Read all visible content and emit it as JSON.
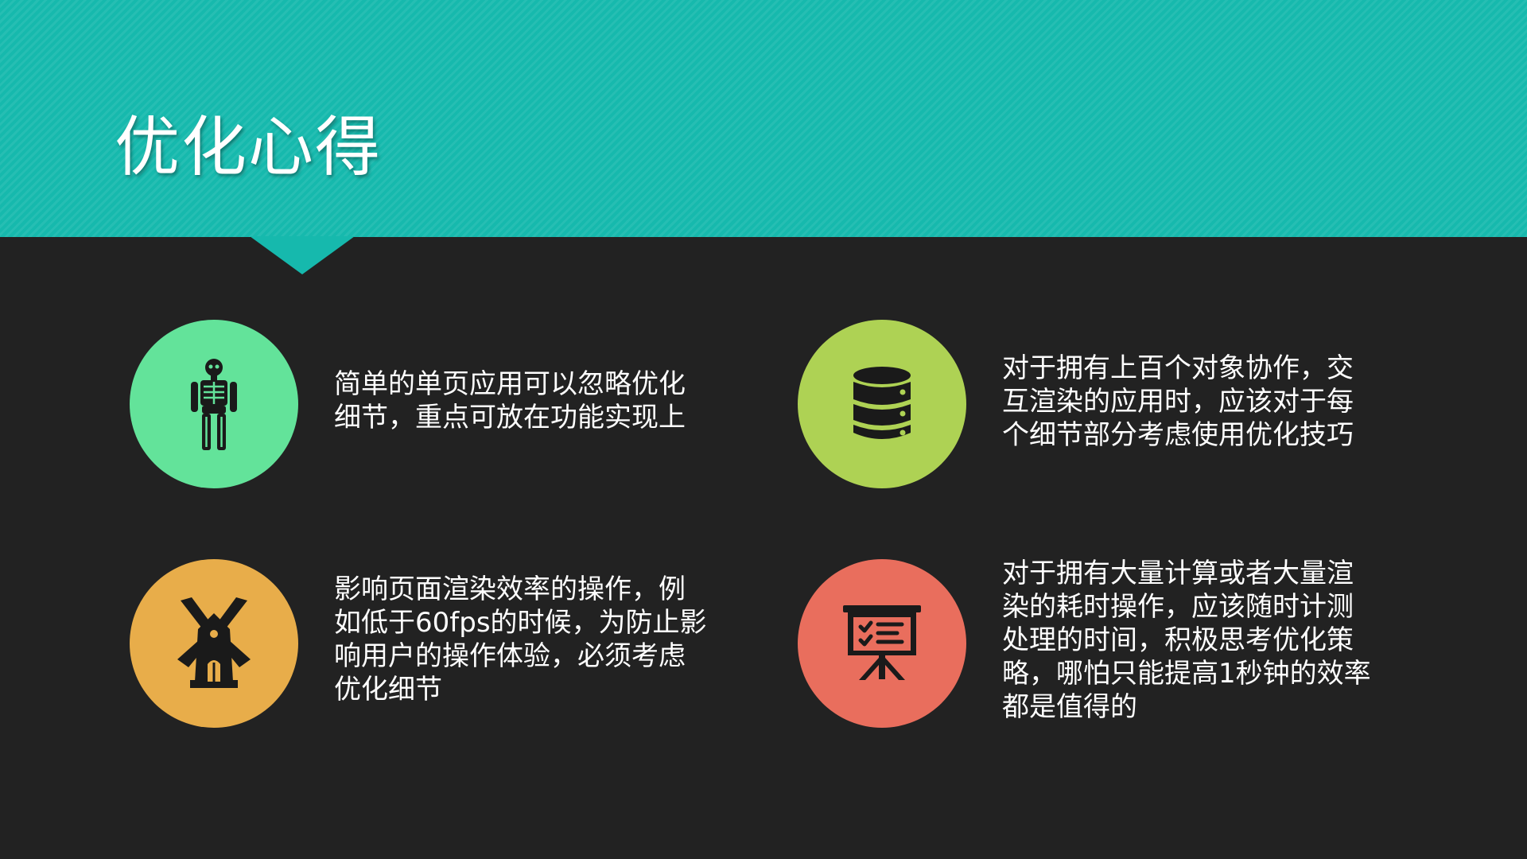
{
  "slide": {
    "title": "优化心得"
  },
  "colors": {
    "banner": "#16b9ad",
    "background": "#222222",
    "text": "#ffffff",
    "icon": "#1a1a1a"
  },
  "items": [
    {
      "icon": "skeleton-icon",
      "color": "#63e39a",
      "text": "简单的单页应用可以忽略优化\n细节，重点可放在功能实现上"
    },
    {
      "icon": "database-icon",
      "color": "#aed254",
      "text": "对于拥有上百个对象协作，交\n互渲染的应用时，应该对于每\n个细节部分考虑使用优化技巧"
    },
    {
      "icon": "windmill-icon",
      "color": "#e8ad4a",
      "text": "影响页面渲染效率的操作，例\n如低于60fps的时候，为防止影\n响用户的操作体验，必须考虑\n优化细节"
    },
    {
      "icon": "presentation-board-icon",
      "color": "#e96e5d",
      "text": "对于拥有大量计算或者大量渲\n染的耗时操作，应该随时计测\n处理的时间，积极思考优化策\n略，哪怕只能提高1秒钟的效率\n都是值得的"
    }
  ]
}
